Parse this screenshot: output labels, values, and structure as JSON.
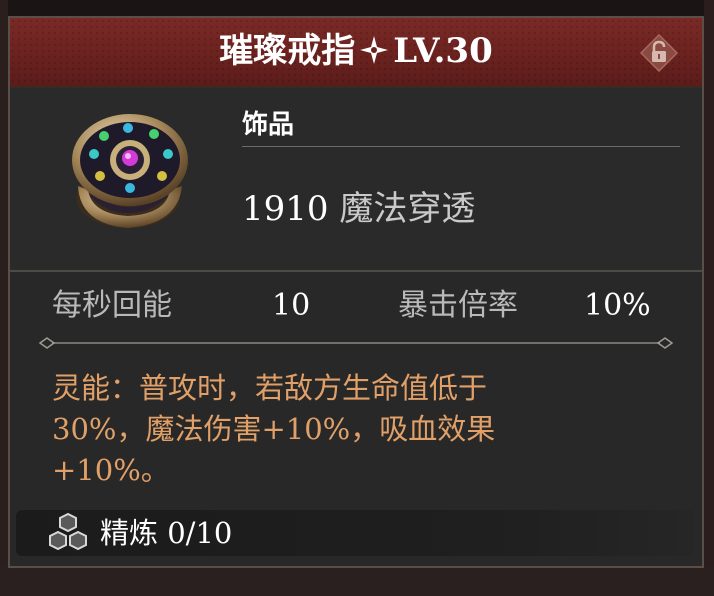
{
  "item": {
    "name": "璀璨戒指",
    "level_text": "LV.30",
    "category": "饰品",
    "main_stat_value": "1910",
    "main_stat_label": "魔法穿透"
  },
  "stats": [
    {
      "label": "每秒回能",
      "value": "10"
    },
    {
      "label": "暴击倍率",
      "value": "10%"
    }
  ],
  "skill": {
    "line1": "灵能：普攻时，若敌方生命值低于",
    "line2": "30%，魔法伤害+10%，吸血效果",
    "line3": "+10%。"
  },
  "refine": {
    "label": "精炼",
    "value": "0/10"
  },
  "icons": [
    "sparkle-star-icon",
    "lock-icon",
    "ring-item-icon",
    "refine-hexagon-icon"
  ],
  "colors": {
    "title_bar": "#6b221f",
    "skill_text": "#e0a067",
    "panel": "#282828"
  }
}
